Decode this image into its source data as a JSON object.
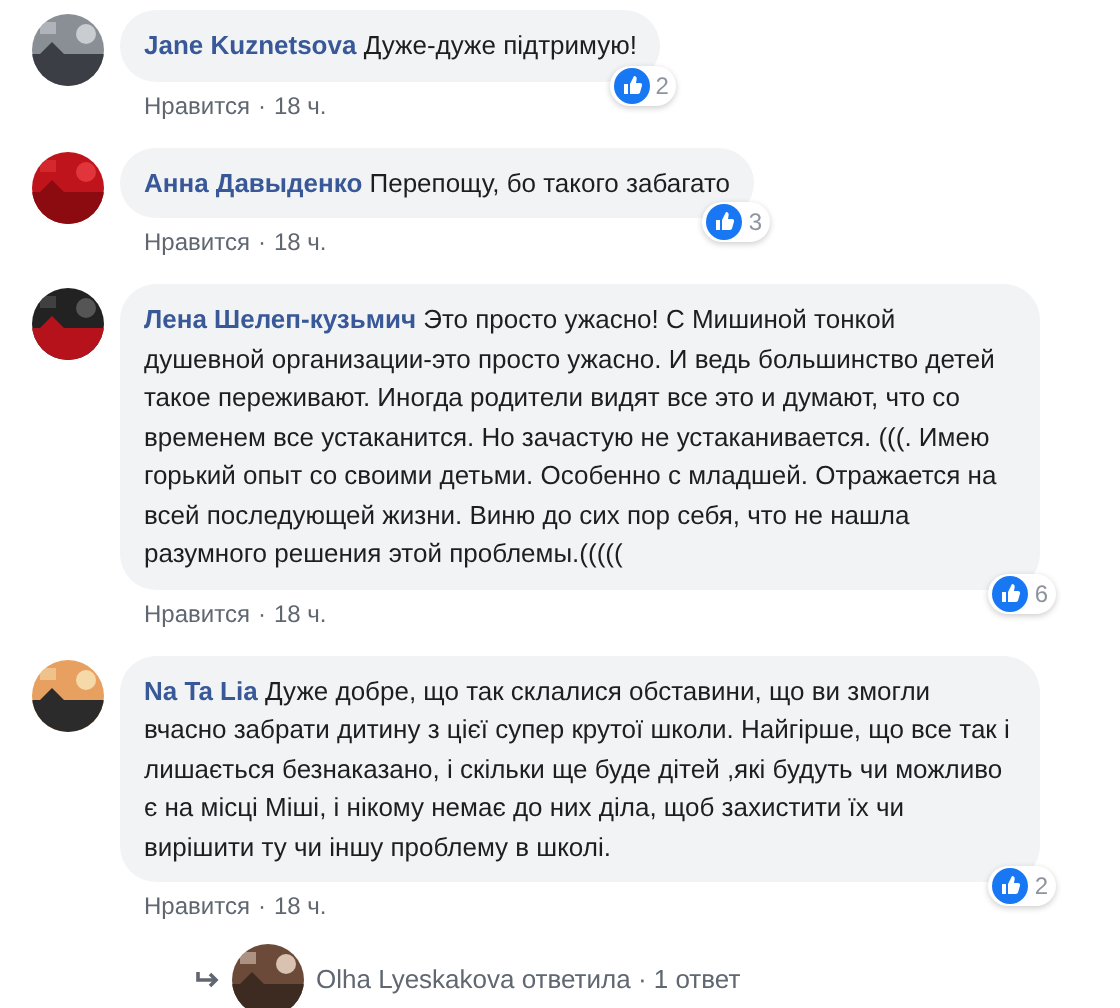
{
  "comments": [
    {
      "author": "Jane Kuznetsova",
      "text": "Дуже-дуже підтримую!",
      "like_label": "Нравится",
      "separator": "·",
      "time": "18 ч.",
      "reactions": "2"
    },
    {
      "author": "Анна Давыденко",
      "text": "Перепощу, бо такого забагато",
      "like_label": "Нравится",
      "separator": "·",
      "time": "18 ч.",
      "reactions": "3"
    },
    {
      "author": "Лена Шелеп-кузьмич",
      "text": "Это просто ужасно! С Мишиной тонкой душевной организации-это просто ужасно. И ведь большинство детей такое переживают. Иногда родители видят все это и думают, что со временем все устаканится. Но зачастую не устаканивается. (((. Имею горький опыт со своими детьми. Особенно с младшей. Отражается на всей последующей жизни. Виню до сих пор себя, что не нашла разумного решения этой проблемы.(((((",
      "like_label": "Нравится",
      "separator": "·",
      "time": "18 ч.",
      "reactions": "6"
    },
    {
      "author": "Na Ta Lia",
      "text": "Дуже добре, що так склалися обставини, що ви змогли вчасно забрати дитину з цієї супер крутої школи. Найгірше, що все так і лишається безнаказано, і скільки ще буде дітей ,які будуть чи можливо є на місці Міші, і нікому немає до них діла, щоб захистити їх чи вирішити ту чи іншу проблему в школі.",
      "like_label": "Нравится",
      "separator": "·",
      "time": "18 ч.",
      "reactions": "2"
    }
  ],
  "replies_link": {
    "text": "Olha Lyeskakova ответила · 1 ответ"
  }
}
